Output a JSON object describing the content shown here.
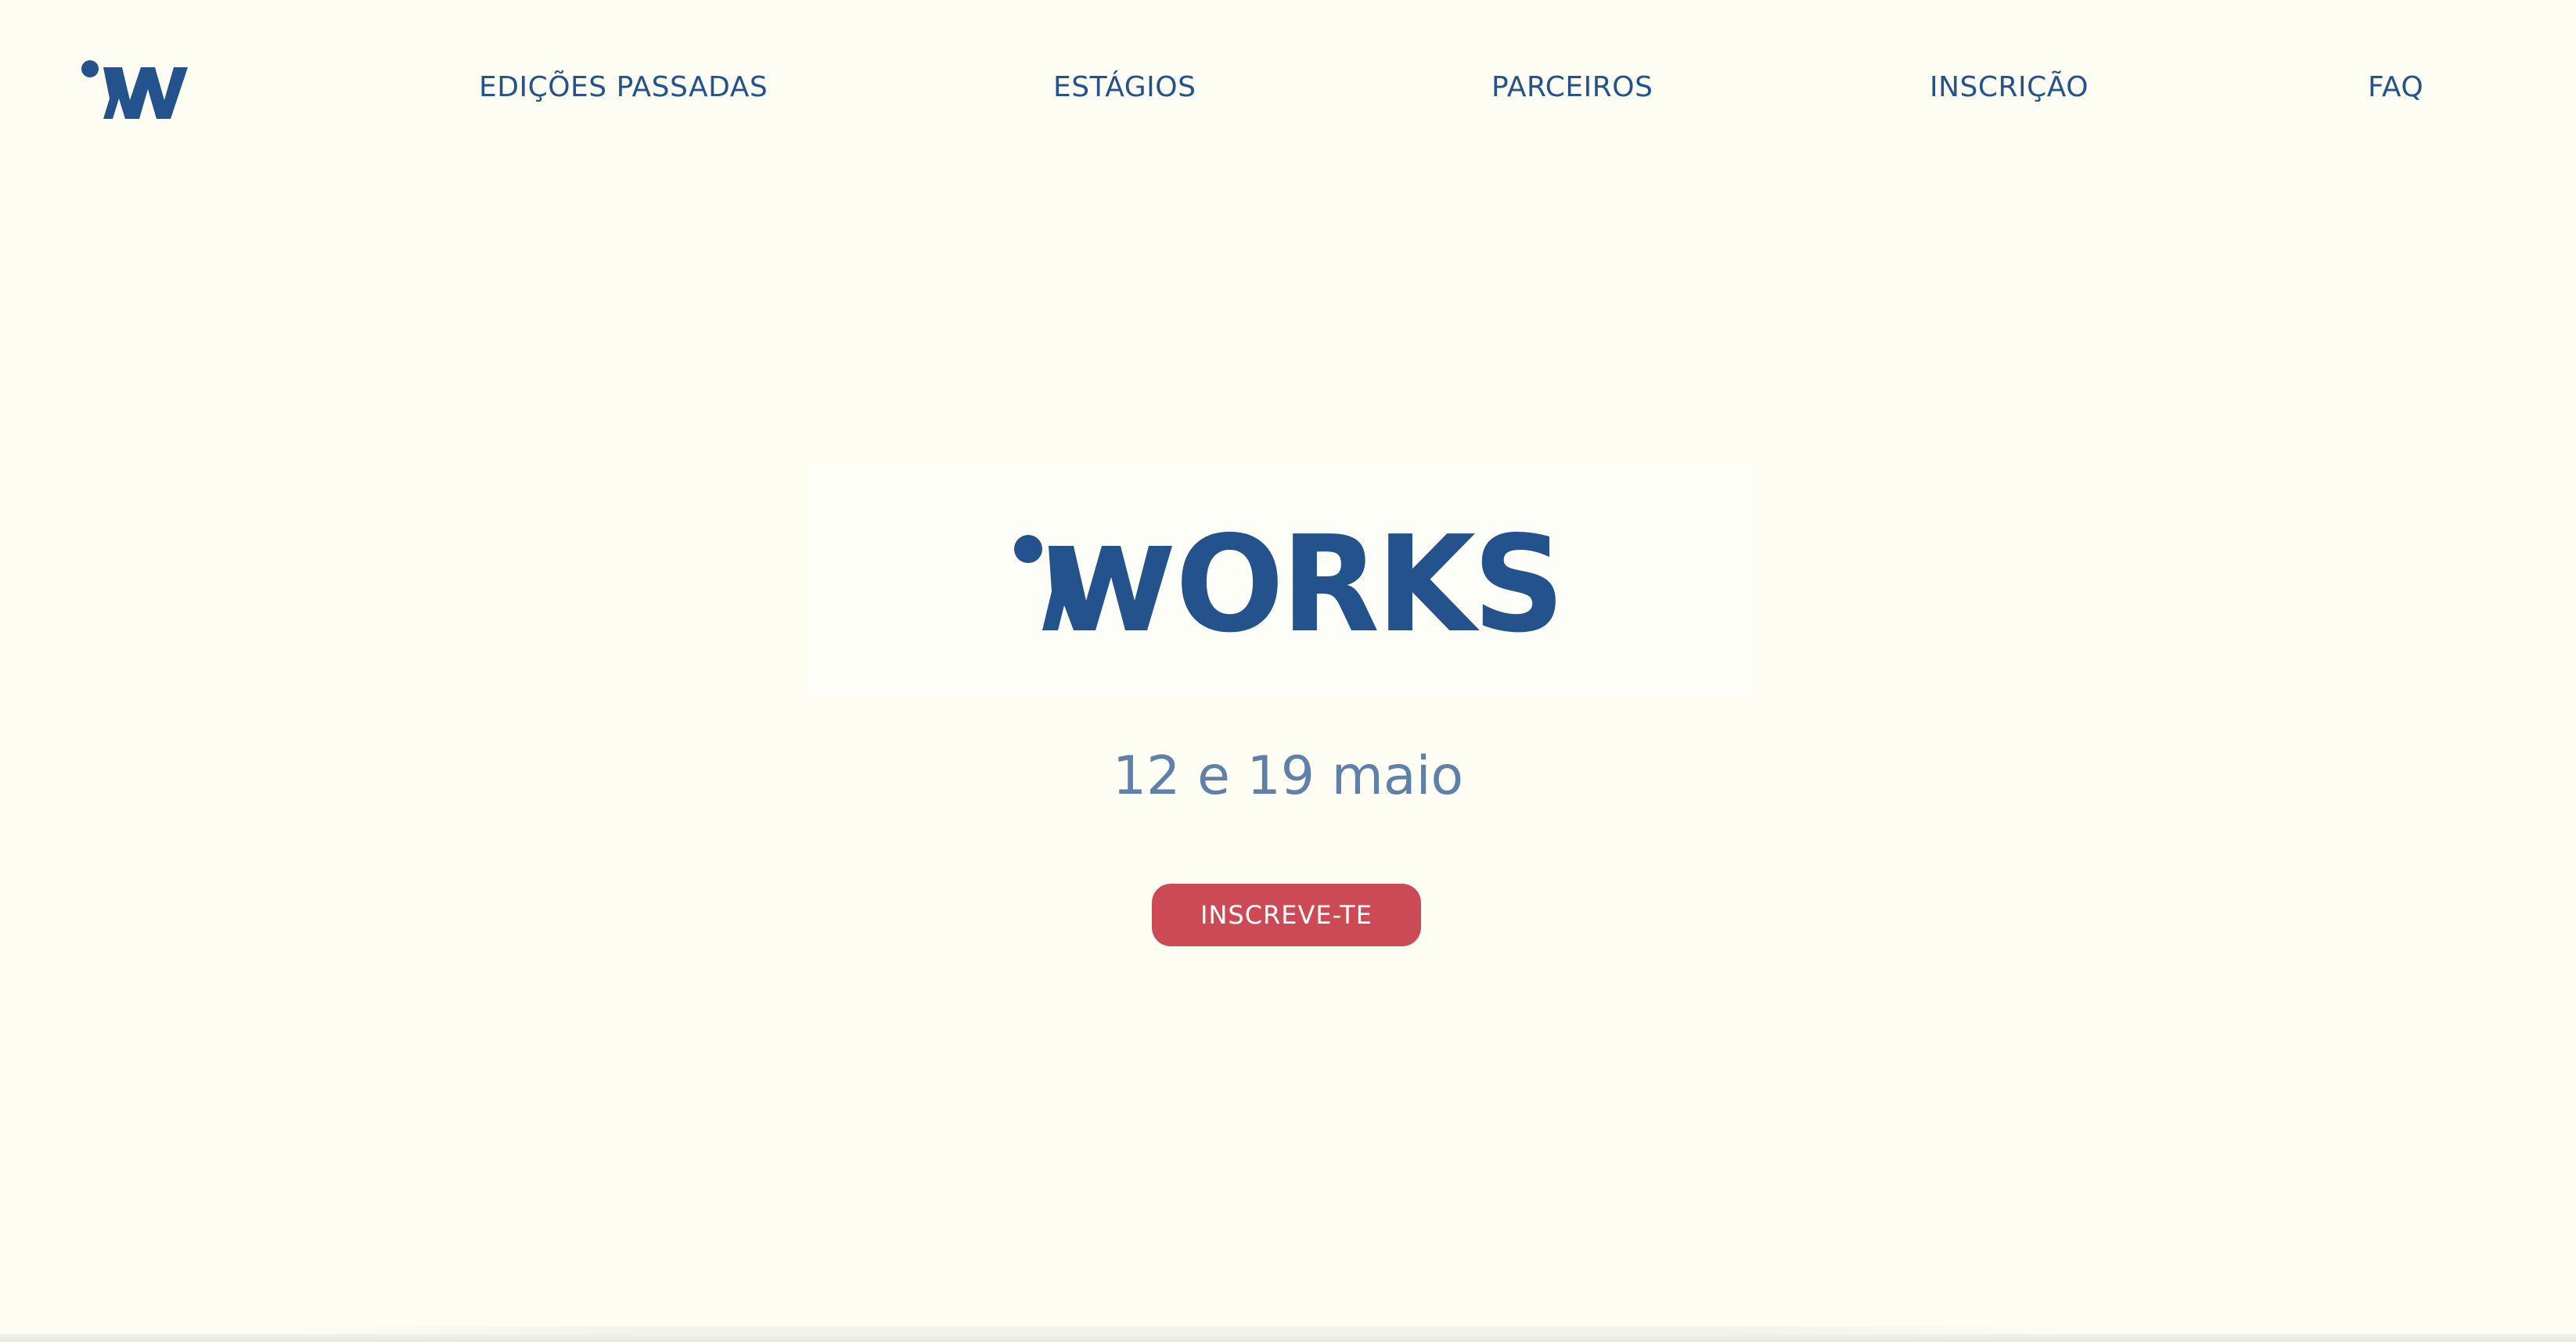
{
  "header": {
    "logo": {
      "icon": "works-w-logo-icon",
      "color": "#24528d"
    },
    "nav": [
      {
        "label": "EDIÇÕES PASSADAS"
      },
      {
        "label": "ESTÁGIOS"
      },
      {
        "label": "PARCEIROS"
      },
      {
        "label": "INSCRIÇÃO"
      },
      {
        "label": "FAQ"
      }
    ]
  },
  "hero": {
    "wordmark": "WORKS",
    "wordmark_color": "#24528d",
    "dates": "12 e 19 maio",
    "cta_label": "INSCREVE-TE",
    "cta_color": "#cc4a56"
  },
  "colors": {
    "background": "#fdfdf4",
    "primary": "#24528d",
    "muted_text": "#5f80a9",
    "accent": "#cc4a56"
  }
}
